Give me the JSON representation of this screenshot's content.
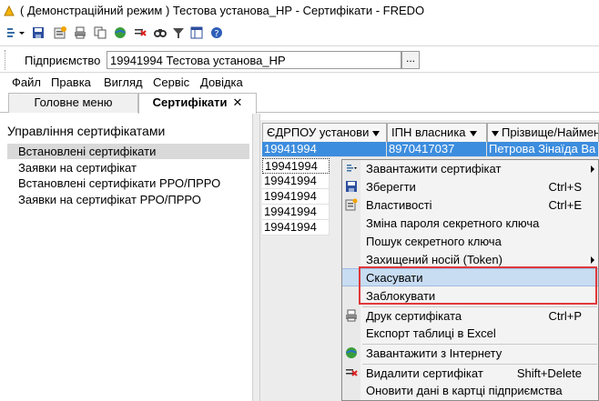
{
  "window": {
    "title": "( Демонстраційний режим ) Тестова установа_НР - Сертифікати - FREDO"
  },
  "toolbar": {
    "icons": [
      "add-dropdown-icon",
      "save-icon",
      "properties-icon",
      "print-icon",
      "globe-icon",
      "delete-icon",
      "find-icon",
      "filter-icon",
      "grid-icon",
      "help-icon"
    ]
  },
  "enterprise": {
    "label": "Підприємство",
    "value": "19941994  Тестова установа_НР",
    "browse": "..."
  },
  "menu": {
    "items": [
      "Файл",
      "Правка",
      "Вигляд",
      "Сервіс",
      "Довідка"
    ]
  },
  "tabs": [
    {
      "label": "Головне меню"
    },
    {
      "label": "Сертифікати",
      "close": "✕"
    }
  ],
  "left_panel": {
    "heading": "Управління сертифікатами",
    "items": [
      "Встановлені сертифікати",
      "Заявки на сертифікат",
      "Встановлені сертифікати РРО/ПРРО",
      "Заявки на сертифікат РРО/ПРРО"
    ]
  },
  "grid": {
    "columns": [
      "ЄДРПОУ установи",
      "ІПН власника",
      "Прізвище/Ім'я/По батькові"
    ],
    "header_visible": [
      "ЄДРПОУ установи",
      "ІПН власника",
      "Прізвище/Найменування"
    ],
    "rows": [
      [
        "19941994",
        "8970417037",
        "Петрова Зінаїда Ва"
      ],
      [
        "19941994",
        "",
        ""
      ],
      [
        "19941994",
        "",
        ""
      ],
      [
        "19941994",
        "",
        ""
      ],
      [
        "19941994",
        "",
        ""
      ],
      [
        "19941994",
        "",
        ""
      ]
    ]
  },
  "context_menu": {
    "items": [
      {
        "label": "Завантажити сертифікат",
        "icon": "add-dropdown-icon",
        "submenu": true
      },
      {
        "label": "Зберегти",
        "shortcut": "Ctrl+S",
        "icon": "save-icon"
      },
      {
        "label": "Властивості",
        "shortcut": "Ctrl+E",
        "icon": "properties-icon"
      },
      {
        "label": "Зміна пароля секретного ключа"
      },
      {
        "label": "Пошук секретного ключа"
      },
      {
        "label": "Захищений носій (Token)",
        "submenu": true
      },
      {
        "label": "Скасувати",
        "highlighted": true
      },
      {
        "label": "Заблокувати"
      },
      {
        "label": "Друк сертифіката",
        "shortcut": "Ctrl+P",
        "icon": "print-icon"
      },
      {
        "label": "Експорт таблиці в Excel"
      },
      {
        "label": "Завантажити з Інтернету",
        "icon": "globe-icon"
      },
      {
        "label": "Видалити сертифікат",
        "shortcut": "Shift+Delete",
        "icon": "delete-icon"
      },
      {
        "label": "Оновити дані в картці підприємства"
      }
    ]
  },
  "colors": {
    "selection": "#3c8dde",
    "menu_highlight": "#c8dcf2",
    "annotation_box": "#e0383b"
  }
}
